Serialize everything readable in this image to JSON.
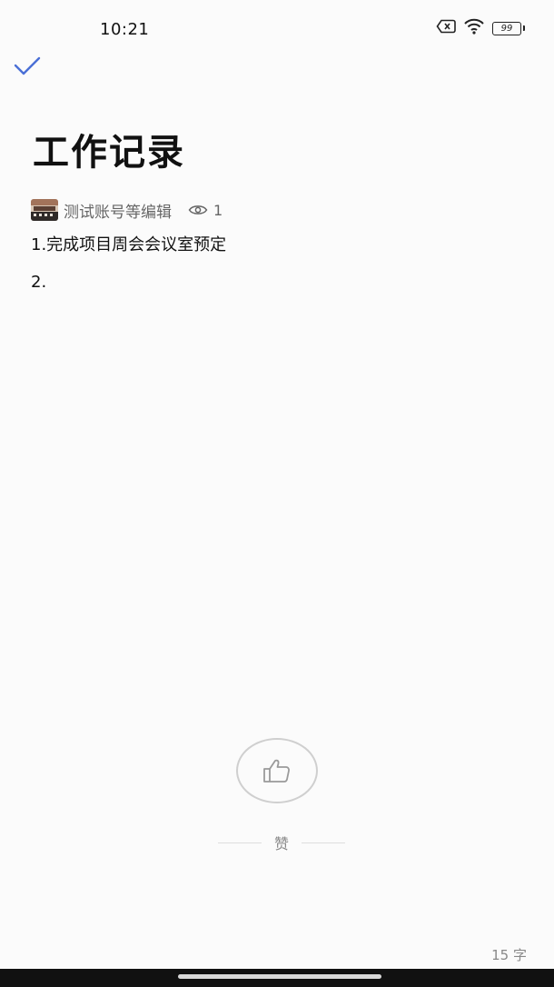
{
  "status_bar": {
    "time": "10:21",
    "battery": "99",
    "icons": [
      "sim-off-icon",
      "wifi-icon",
      "battery-icon"
    ]
  },
  "toolbar": {
    "done_icon": "check-icon",
    "accent_color": "#4a6fd6"
  },
  "document": {
    "title": "工作记录",
    "editor": "测试账号等编辑",
    "views": "1",
    "lines": [
      "1.完成项目周会会议室预定",
      "2."
    ]
  },
  "like": {
    "label": "赞",
    "icon": "thumbs-up-icon"
  },
  "footer": {
    "word_count": "15 字"
  }
}
